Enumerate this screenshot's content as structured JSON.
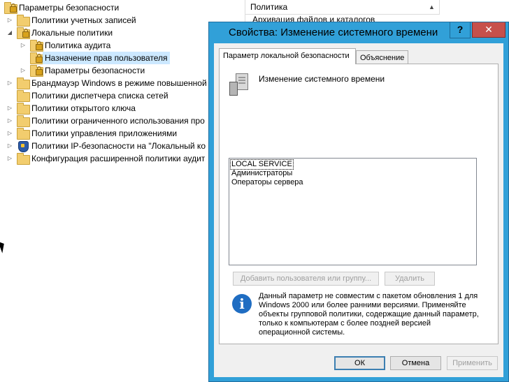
{
  "tree": {
    "items": [
      {
        "label": "Параметры безопасности",
        "icon": "shield-folder-icon",
        "arrow": ""
      },
      {
        "label": "Политики учетных записей",
        "icon": "folder-icon",
        "arrow": "▷"
      },
      {
        "label": "Локальные политики",
        "icon": "folder-icon",
        "arrow": "◢"
      },
      {
        "label": "Политика аудита",
        "icon": "folder-icon",
        "arrow": "▷"
      },
      {
        "label": "Назначение прав пользователя",
        "icon": "folder-icon",
        "arrow": ""
      },
      {
        "label": "Параметры безопасности",
        "icon": "folder-icon",
        "arrow": "▷"
      },
      {
        "label": "Брандмауэр Windows в режиме повышенной",
        "icon": "folder-icon",
        "arrow": "▷"
      },
      {
        "label": "Политики диспетчера списка сетей",
        "icon": "folder-icon",
        "arrow": ""
      },
      {
        "label": "Политики открытого ключа",
        "icon": "folder-icon",
        "arrow": "▷"
      },
      {
        "label": "Политики ограниченного использования про",
        "icon": "folder-icon",
        "arrow": "▷"
      },
      {
        "label": "Политики управления приложениями",
        "icon": "folder-icon",
        "arrow": "▷"
      },
      {
        "label": "Политики IP-безопасности на \"Локальный ко",
        "icon": "shield-icon",
        "arrow": "▷"
      },
      {
        "label": "Конфигурация расширенной политики аудит",
        "icon": "folder-icon",
        "arrow": "▷"
      }
    ]
  },
  "list": {
    "column_header": "Политика",
    "sort_arrow": "▲",
    "first_row": "Архивация файлов и каталогов"
  },
  "dialog": {
    "title": "Свойства: Изменение системного времени",
    "help_label": "?",
    "close_label": "✕",
    "tabs": [
      "Параметр локальной безопасности",
      "Объяснение"
    ],
    "policy_name": "Изменение системного времени",
    "accounts": [
      "LOCAL SERVICE",
      "Администраторы",
      "Операторы сервера"
    ],
    "add_button": "Добавить пользователя или группу...",
    "remove_button": "Удалить",
    "info_symbol": "i",
    "info_text": "Данный параметр не совместим с пакетом обновления 1 для Windows 2000 или более ранними версиями. Применяйте объекты групповой политики, содержащие данный параметр, только к компьютерам с более поздней версией операционной системы.",
    "ok_button": "ОК",
    "cancel_button": "Отмена",
    "apply_button": "Применить"
  }
}
